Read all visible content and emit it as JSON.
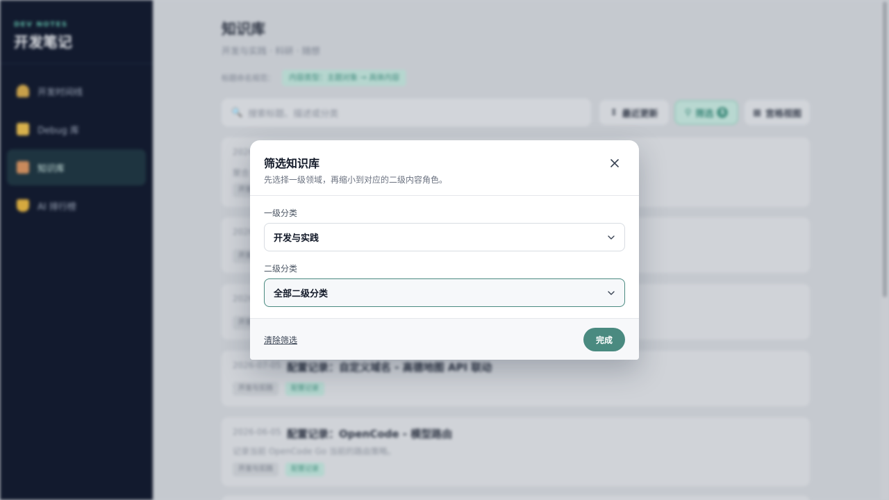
{
  "colors": {
    "accent": "#4a8a80",
    "sidebar_bg": "#121a2e",
    "overlay": "#c5c9cf"
  },
  "sidebar": {
    "brand_sub": "DEV NOTES",
    "brand_title": "开发笔记",
    "items": [
      {
        "label": "开发时间线",
        "icon": "person-icon",
        "active": false
      },
      {
        "label": "Debug 库",
        "icon": "notebook-icon",
        "active": false
      },
      {
        "label": "知识库",
        "icon": "books-icon",
        "active": true
      },
      {
        "label": "AI 排行榜",
        "icon": "trophy-icon",
        "active": false
      }
    ]
  },
  "main": {
    "title": "知识库",
    "subtitle": "开发与实践 · 科研 · 随想",
    "naming_rule_label": "标题命名规范：",
    "naming_rule_chip": "内容类型：主题对象 → 具体内容",
    "search_placeholder": "搜索标题、描述或分类",
    "toolbar": {
      "sort_label": "最近更新",
      "filter_label": "筛选",
      "filter_count": "1",
      "view_label": "宫格视图"
    },
    "cards": [
      {
        "date": "2026",
        "title": "",
        "desc": "聚合",
        "chips": [
          {
            "text": "开发",
            "style": "gray"
          }
        ]
      },
      {
        "date": "2026",
        "title": "",
        "desc": "",
        "chips": [
          {
            "text": "开发",
            "style": "gray"
          }
        ]
      },
      {
        "date": "2026",
        "title": "",
        "desc": "",
        "chips": [
          {
            "text": "开发",
            "style": "gray"
          }
        ]
      },
      {
        "date": "2026-07-05",
        "title": "配置记录：自定义域名 - 高德地图 API 联动",
        "desc": "",
        "chips": [
          {
            "text": "开发与实践",
            "style": "gray"
          },
          {
            "text": "配置记录",
            "style": "teal"
          }
        ]
      },
      {
        "date": "2026-06-05",
        "title": "配置记录：OpenCode - 模型路由",
        "desc": "记录当前 OpenCode Go 当前的路由策略。",
        "chips": [
          {
            "text": "开发与实践",
            "style": "gray"
          },
          {
            "text": "配置记录",
            "style": "teal"
          }
        ]
      }
    ]
  },
  "modal": {
    "title": "筛选知识库",
    "description": "先选择一级领域，再缩小到对应的二级内容角色。",
    "close_icon": "close-icon",
    "level1_label": "一级分类",
    "level1_value": "开发与实践",
    "level2_label": "二级分类",
    "level2_value": "全部二级分类",
    "clear_label": "清除筛选",
    "done_label": "完成"
  }
}
